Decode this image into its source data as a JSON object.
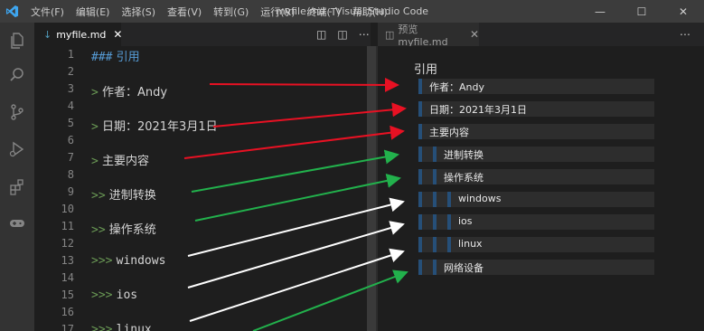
{
  "titlebar": {
    "menu": [
      "文件(F)",
      "编辑(E)",
      "选择(S)",
      "查看(V)",
      "转到(G)",
      "运行(R)",
      "终端(T)",
      "帮助(H)"
    ],
    "window_title": "myfile.md - Visual Studio Code"
  },
  "activity_bar": {
    "icons": [
      "explorer-icon",
      "search-icon",
      "source-control-icon",
      "run-debug-icon",
      "extensions-icon",
      "remote-gamepad-icon"
    ]
  },
  "editor": {
    "tab_label": "myfile.md",
    "line_numbers": [
      "1",
      "2",
      "3",
      "4",
      "5",
      "6",
      "7",
      "8",
      "9",
      "10",
      "11",
      "12",
      "13",
      "14",
      "15",
      "16",
      "17"
    ],
    "lines": [
      {
        "line": 1,
        "marker": "###",
        "text": "引用",
        "kind": "heading"
      },
      {
        "line": 3,
        "marker": ">",
        "text": "作者：Andy",
        "kind": "quote"
      },
      {
        "line": 5,
        "marker": ">",
        "text": "日期：2021年3月1日",
        "kind": "quote"
      },
      {
        "line": 7,
        "marker": ">",
        "text": "主要内容",
        "kind": "quote"
      },
      {
        "line": 9,
        "marker": ">>",
        "text": "进制转换",
        "kind": "quote"
      },
      {
        "line": 11,
        "marker": ">>",
        "text": "操作系统",
        "kind": "quote"
      },
      {
        "line": 13,
        "marker": ">>>",
        "text": "windows",
        "kind": "quote"
      },
      {
        "line": 15,
        "marker": ">>>",
        "text": "ios",
        "kind": "quote"
      },
      {
        "line": 17,
        "marker": ">>>",
        "text": "linux",
        "kind": "quote"
      }
    ]
  },
  "preview": {
    "tab_label": "预览 myfile.md",
    "heading": "引用",
    "items": [
      {
        "text": "作者：Andy",
        "level": 1
      },
      {
        "text": "日期：2021年3月1日",
        "level": 1
      },
      {
        "text": "主要内容",
        "level": 1
      },
      {
        "text": "进制转换",
        "level": 2
      },
      {
        "text": "操作系统",
        "level": 2
      },
      {
        "text": "windows",
        "level": 3
      },
      {
        "text": "ios",
        "level": 3
      },
      {
        "text": "linux",
        "level": 3
      },
      {
        "text": "网络设备",
        "level": 2
      }
    ]
  },
  "annotation_colors": {
    "red": "#e81123",
    "green": "#22b14c",
    "white": "#ffffff"
  }
}
